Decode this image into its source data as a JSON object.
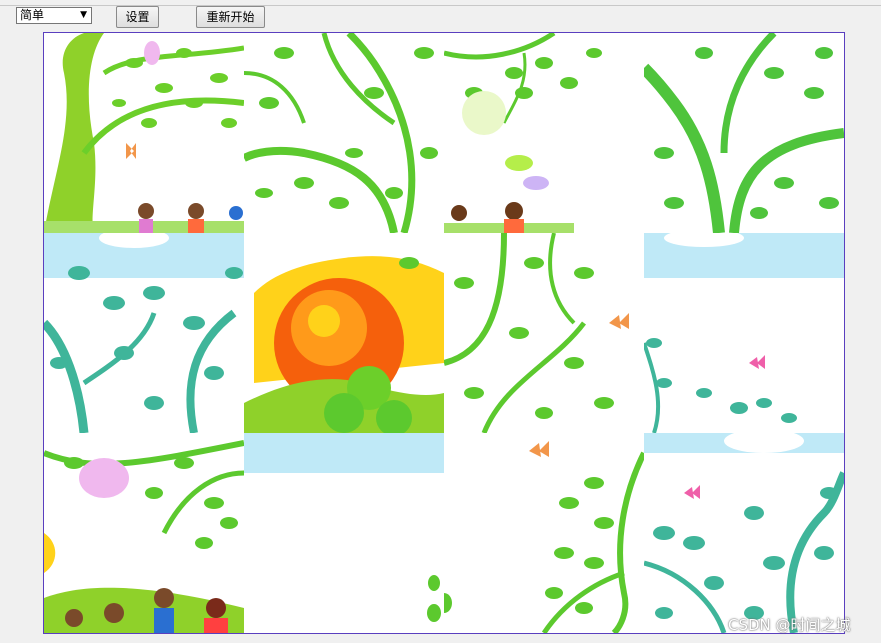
{
  "toolbar": {
    "difficulty_selected": "简单",
    "settings_label": "设置",
    "restart_label": "重新开始"
  },
  "board": {
    "rows": 3,
    "cols": 4,
    "tile_colors": {
      "leaf_green": "#5cc92e",
      "teal_leaf": "#3fb59a",
      "sky_blue": "#bfe9f7",
      "sun_orange": "#f5600c",
      "sun_yellow": "#ffd21a",
      "butterfly_pink": "#ef5fa9",
      "butterfly_orange": "#f2964a"
    }
  },
  "watermark": "CSDN @时间之城"
}
